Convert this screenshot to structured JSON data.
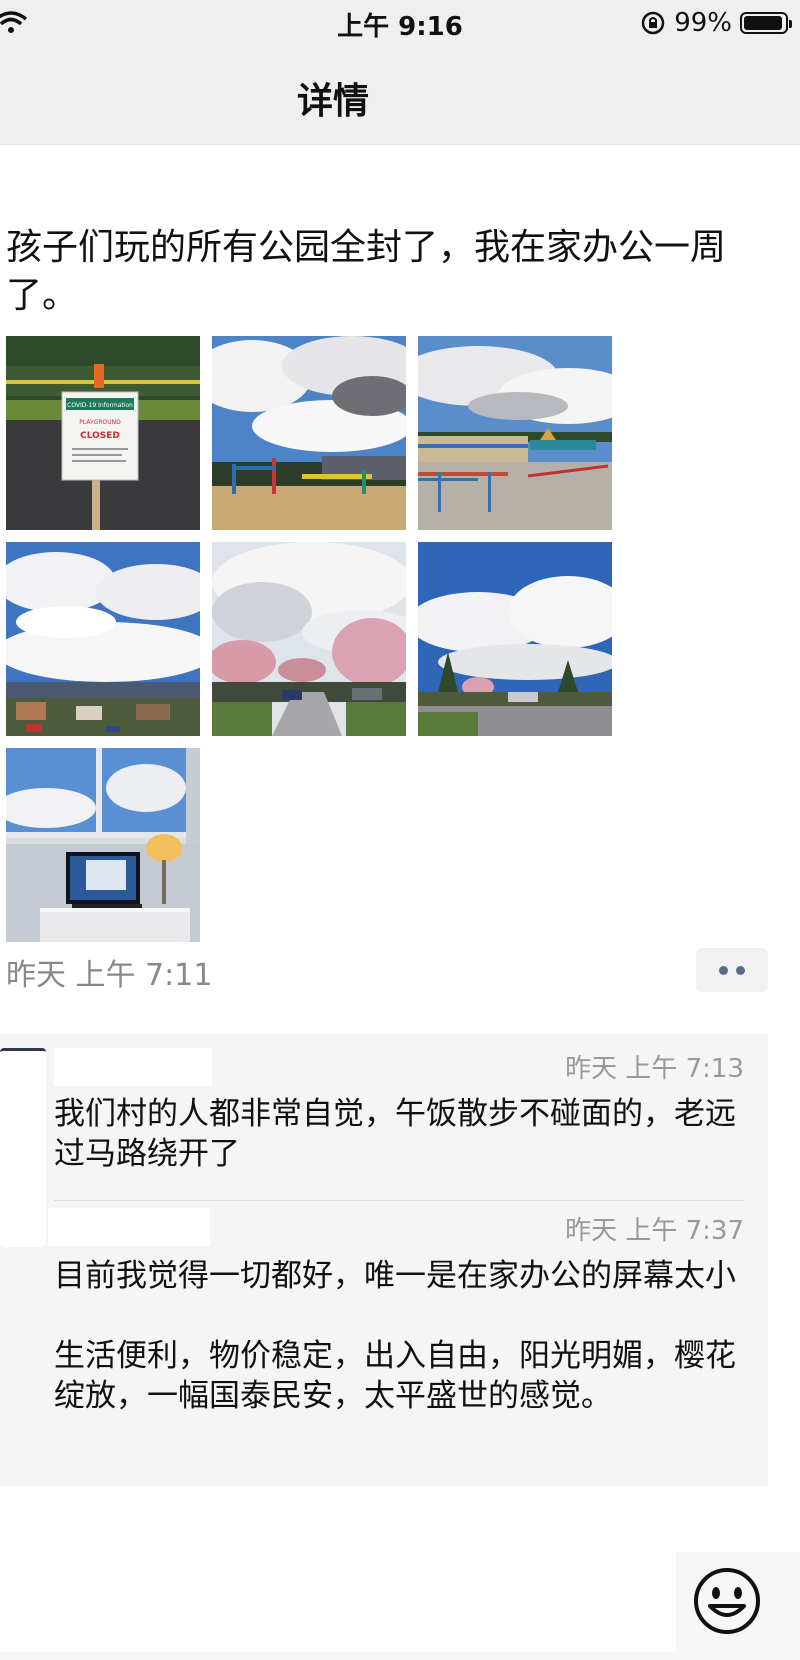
{
  "status_bar": {
    "time": "上午 9:16",
    "battery": "99%"
  },
  "nav": {
    "title": "详情"
  },
  "post": {
    "text": "孩子们玩的所有公园全封了，我在家办公一周了。",
    "time": "昨天 上午 7:11",
    "images": [
      "playground-closed-sign",
      "playground-clouds",
      "school-playground",
      "neighborhood-sky",
      "cherry-blossom-street",
      "street-clouds",
      "home-office-desk"
    ],
    "sign": {
      "title": "COVID-19 Information",
      "sub": "PLAYGROUND",
      "closed": "CLOSED"
    }
  },
  "comments": [
    {
      "time": "昨天 上午 7:13",
      "text": "我们村的人都非常自觉，午饭散步不碰面的，老远过马路绕开了"
    },
    {
      "time": "昨天 上午 7:37",
      "text": "目前我觉得一切都好，唯一是在家办公的屏幕太小\n\n生活便利，物价稳定，出入自由，阳光明媚，樱花绽放，一幅国泰民安，太平盛世的感觉。"
    }
  ],
  "icons": {
    "more": "more-dots-icon",
    "emoji": "emoji-icon",
    "wifi": "wifi-icon",
    "battery": "battery-icon",
    "lock": "rotation-lock-icon"
  },
  "colors": {
    "more_dots": "#5a6b8a",
    "comment_bg": "#f5f5f5",
    "nav_bg": "#efefef"
  }
}
